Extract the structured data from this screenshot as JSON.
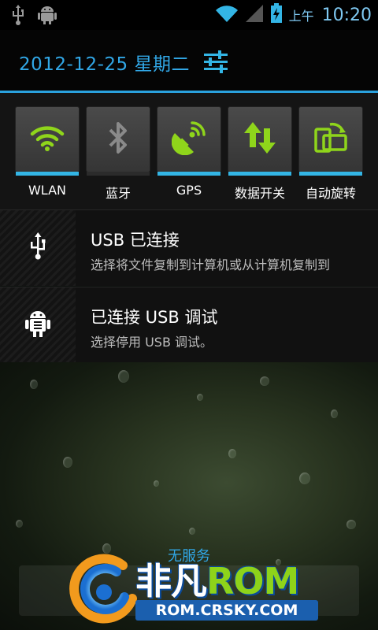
{
  "status_bar": {
    "ampm": "上午",
    "time": "10:20",
    "icons": [
      "usb-icon",
      "android-debug-icon",
      "wifi-icon",
      "signal-icon",
      "battery-charging-icon"
    ]
  },
  "header": {
    "date": "2012-12-25 星期二",
    "settings_icon": "settings-sliders-icon"
  },
  "colors": {
    "accent": "#33b5e5",
    "toggle_on_icon": "#8fd51b",
    "toggle_off_icon": "#8a8a8a"
  },
  "toggles": [
    {
      "label": "WLAN",
      "icon": "wifi-icon",
      "on": true
    },
    {
      "label": "蓝牙",
      "icon": "bluetooth-icon",
      "on": false
    },
    {
      "label": "GPS",
      "icon": "gps-icon",
      "on": true
    },
    {
      "label": "数据开关",
      "icon": "data-transfer-icon",
      "on": true
    },
    {
      "label": "自动旋转",
      "icon": "rotate-icon",
      "on": true
    }
  ],
  "notifications": [
    {
      "title": "USB 已连接",
      "text": "选择将文件复制到计算机或从计算机复制到",
      "icon": "usb-icon"
    },
    {
      "title": "已连接 USB 调试",
      "text": "选择停用 USB 调试。",
      "icon": "android-debug-icon"
    }
  ],
  "bottom": {
    "no_service": "无服务"
  },
  "watermark": {
    "brand_cn": "非凡",
    "brand_en": "ROM",
    "url": "ROM.CRSKY.COM"
  }
}
